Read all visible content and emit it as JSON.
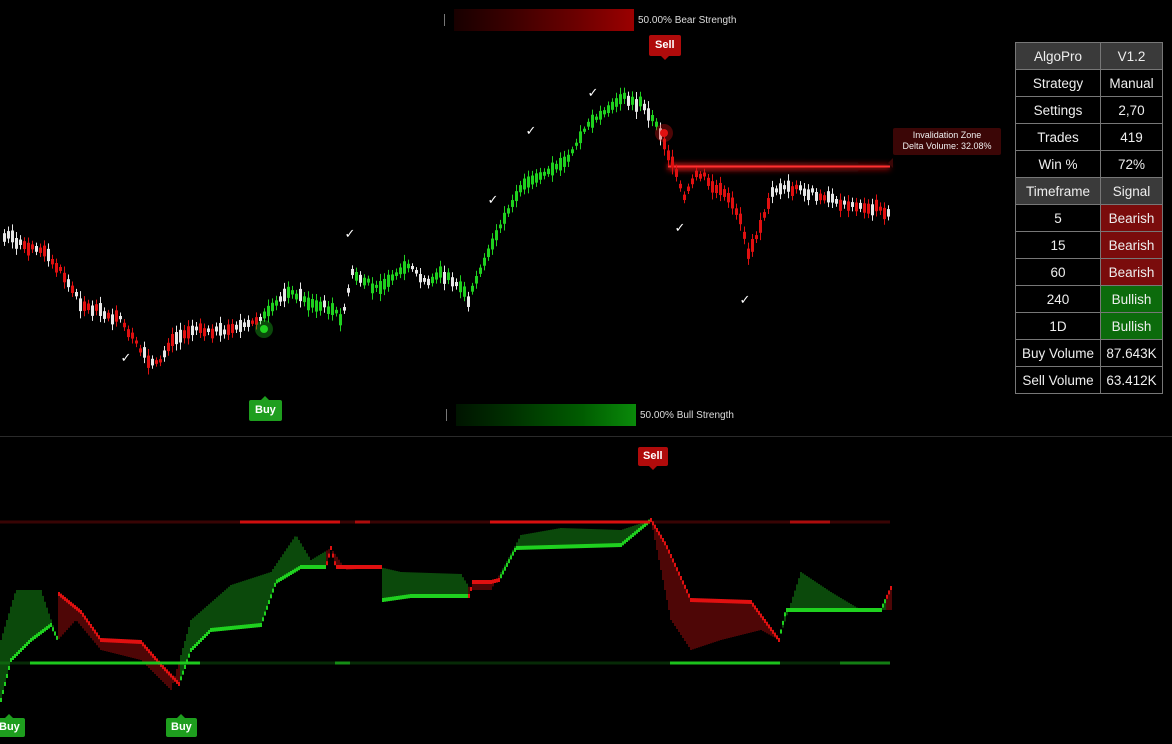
{
  "strength": {
    "bear_label": "50.00% Bear Strength",
    "bull_label": "50.00% Bull Strength"
  },
  "signals": {
    "sell": "Sell",
    "buy": "Buy"
  },
  "invalidation": {
    "line1": "Invalidation Zone",
    "line2": "Delta Volume: 32.08%"
  },
  "check_mark": "✓",
  "table": {
    "rows": [
      {
        "label": "AlgoPro",
        "value": "V1.2",
        "style": "header"
      },
      {
        "label": "Strategy",
        "value": "Manual",
        "style": "plain"
      },
      {
        "label": "Settings",
        "value": "2,70",
        "style": "plain"
      },
      {
        "label": "Trades",
        "value": "419",
        "style": "plain"
      },
      {
        "label": "Win %",
        "value": "72%",
        "style": "plain"
      },
      {
        "label": "Timeframe",
        "value": "Signal",
        "style": "header"
      },
      {
        "label": "5",
        "value": "Bearish",
        "style": "bear"
      },
      {
        "label": "15",
        "value": "Bearish",
        "style": "bear"
      },
      {
        "label": "60",
        "value": "Bearish",
        "style": "bear"
      },
      {
        "label": "240",
        "value": "Bullish",
        "style": "bull"
      },
      {
        "label": "1D",
        "value": "Bullish",
        "style": "bull"
      },
      {
        "label": "Buy Volume",
        "value": "87.643K",
        "style": "plain"
      },
      {
        "label": "Sell Volume",
        "value": "63.412K",
        "style": "plain"
      }
    ]
  },
  "colors": {
    "bull": "#1fd11f",
    "bear": "#e01010",
    "neutral": "#e6e6e6",
    "background": "#000000",
    "bull_badge": "#0c6b0c",
    "bear_badge": "#7a0c0c"
  }
}
